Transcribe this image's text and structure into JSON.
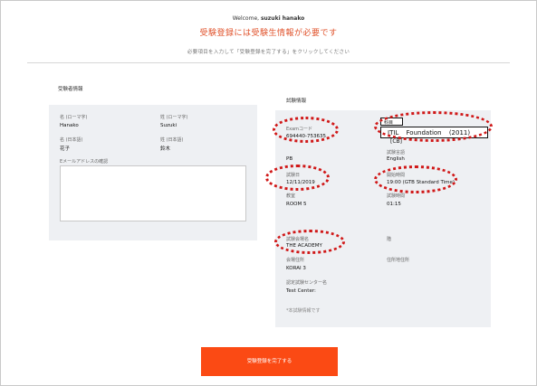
{
  "header": {
    "welcome_prefix": "Welcome,",
    "user_name": "suzuki hanako",
    "notice": "受験登録には受験生情報が必要です",
    "instruction": "必要項目を入力して「受験登録を完了する」をクリックしてください"
  },
  "candidate": {
    "heading": "受験者情報",
    "last_name_roman_label": "名 (ローマ字)",
    "first_name_roman_label": "姓 (ローマ字)",
    "last_name_roman": "Hanako",
    "first_name_roman": "Suzuki",
    "last_name_kanji_label": "名 (日本語)",
    "first_name_kanji_label": "姓 (日本語)",
    "last_name_kanji": "花子",
    "first_name_kanji": "鈴木",
    "email_confirm_label": "Eメールアドレスの確認",
    "email_confirm_value": ""
  },
  "exam": {
    "heading": "試験情報",
    "exam_code_label": "Examコード",
    "exam_code": "694440-753635",
    "subject_label": "科目",
    "subject_text": "ITIL Foundation (2011)",
    "subject_suffix": "[CB]",
    "format": "PB",
    "language_label": "試験言語",
    "language": "English",
    "date_label": "試験日",
    "date": "12/11/2019",
    "start_time_label": "開始時間",
    "start_time": "19:00 (GTB Standard Time)",
    "room_label": "教室",
    "room": "ROOM 5",
    "duration_label": "試験時間",
    "duration": "01:15",
    "venue_label": "試験会場名",
    "venue": "THE ACADEMY",
    "floor_label": "階",
    "address_label": "会場住所",
    "address": "KORAI 3",
    "location_label": "住所地住所",
    "test_center_label": "認定試験センター名",
    "test_center": "Test Center:",
    "footnote": "*本試験情報です"
  },
  "actions": {
    "submit_label": "受験登録を完了する"
  },
  "colors": {
    "accent": "#fb4a14",
    "notice": "#e0522b",
    "annotation": "#d01818",
    "panel": "#eef0f3"
  }
}
